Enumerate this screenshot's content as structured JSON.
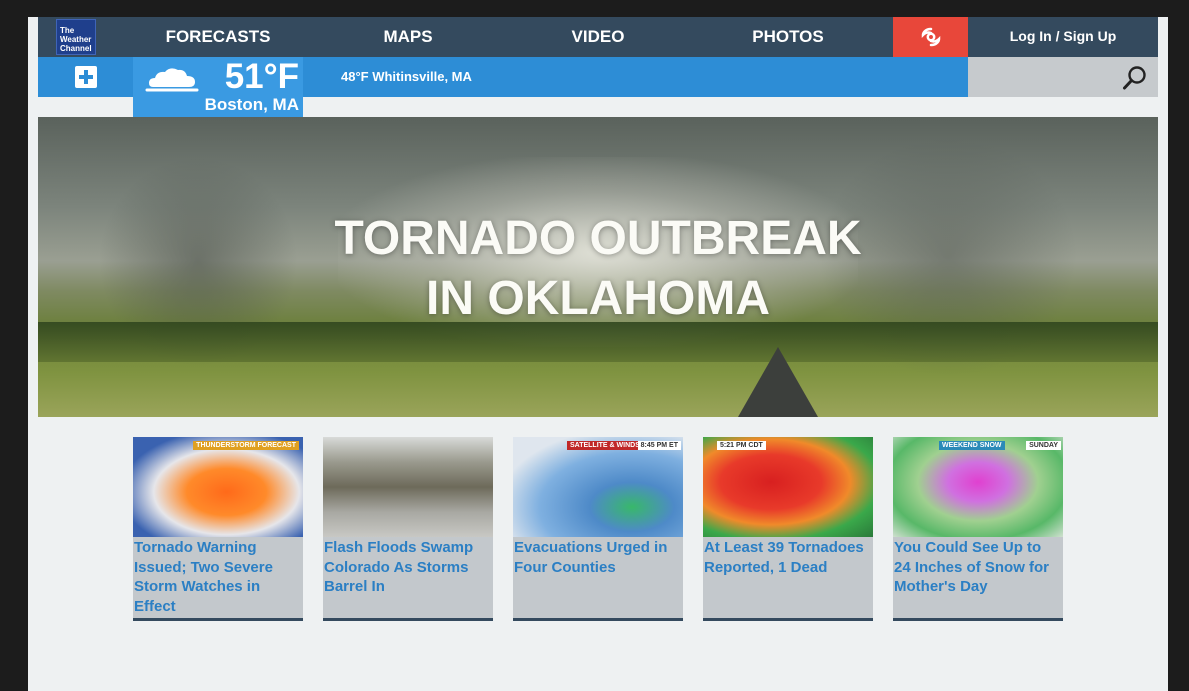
{
  "brand": {
    "logo_text": "The Weather Channel"
  },
  "nav": {
    "items": [
      "FORECASTS",
      "MAPS",
      "VIDEO",
      "PHOTOS"
    ],
    "login_label": "Log In / Sign Up"
  },
  "current": {
    "temperature": "51°F",
    "city": "Boston, MA",
    "other_location": "48°F Whitinsville, MA"
  },
  "hero": {
    "title_line1": "TORNADO OUTBREAK",
    "title_line2": "IN OKLAHOMA"
  },
  "cards": [
    {
      "caption": "Tornado Warning Issued; Two Severe Storm Watches in Effect",
      "thumb_tag": "THUNDERSTORM FORECAST"
    },
    {
      "caption": "Flash Floods Swamp Colorado As Storms Barrel In",
      "thumb_tag": ""
    },
    {
      "caption": "Evacuations Urged in Four Counties",
      "thumb_tag": "SATELLITE & WINDSTREAM",
      "thumb_time": "8:45 PM ET"
    },
    {
      "caption": "At Least 39 Tornadoes Reported, 1 Dead",
      "thumb_tag": "5:21 PM CDT"
    },
    {
      "caption": "You Could See Up to 24 Inches of Snow for Mother's Day",
      "thumb_tag": "WEEKEND SNOW",
      "thumb_time": "SUNDAY"
    }
  ],
  "colors": {
    "nav_bg": "#344a5e",
    "accent_blue": "#2d8dd6",
    "storm_red": "#e8473a",
    "caption_blue": "#2b7fc4"
  },
  "icons": [
    "plus-icon",
    "cloud-icon",
    "hurricane-icon",
    "search-icon"
  ]
}
